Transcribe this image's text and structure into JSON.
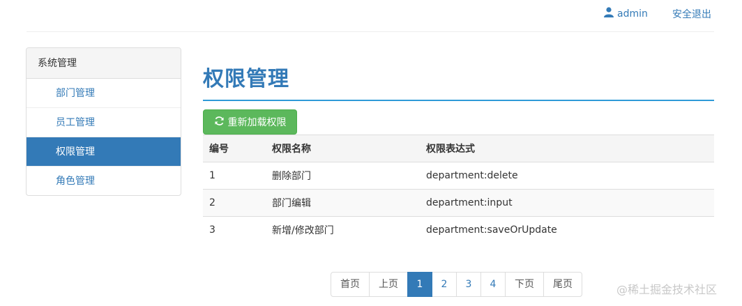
{
  "header": {
    "username": "admin",
    "logout_label": "安全退出"
  },
  "sidebar": {
    "title": "系统管理",
    "items": [
      {
        "label": "部门管理",
        "active": false
      },
      {
        "label": "员工管理",
        "active": false
      },
      {
        "label": "权限管理",
        "active": true
      },
      {
        "label": "角色管理",
        "active": false
      }
    ]
  },
  "main": {
    "title": "权限管理",
    "reload_label": "重新加载权限",
    "table": {
      "columns": [
        "编号",
        "权限名称",
        "权限表达式"
      ],
      "rows": [
        [
          "1",
          "删除部门",
          "department:delete"
        ],
        [
          "2",
          "部门编辑",
          "department:input"
        ],
        [
          "3",
          "新增/修改部门",
          "department:saveOrUpdate"
        ]
      ]
    }
  },
  "pagination": {
    "first": "首页",
    "prev": "上页",
    "pages": [
      "1",
      "2",
      "3",
      "4"
    ],
    "current": "1",
    "next": "下页",
    "last": "尾页"
  },
  "watermark": "@稀土掘金技术社区",
  "colors": {
    "primary": "#337ab7",
    "success": "#5cb85c",
    "rule": "#2f9ad8"
  },
  "icons": {
    "user": "user-icon",
    "reload": "refresh-icon"
  }
}
